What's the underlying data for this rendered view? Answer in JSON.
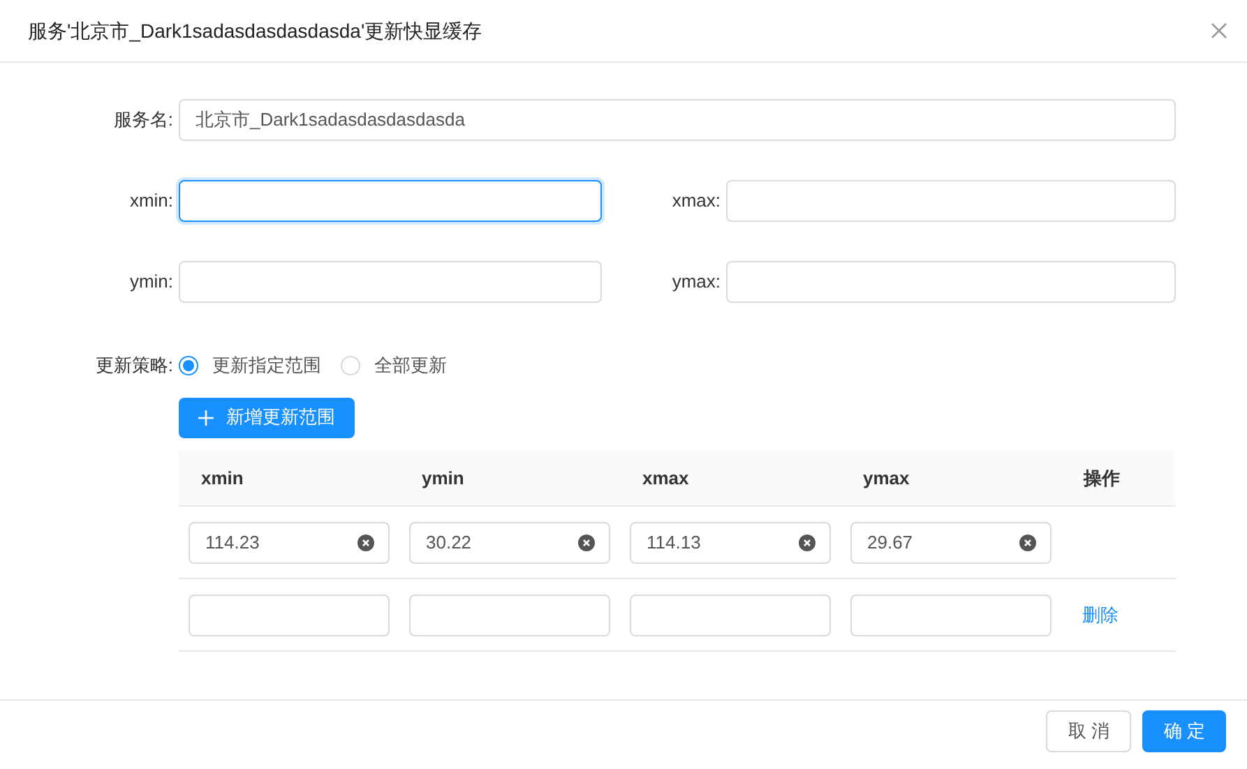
{
  "dialog": {
    "title": "服务'北京市_Dark1sadasdasdasdasda'更新快显缓存"
  },
  "form": {
    "service_name": {
      "label": "服务名:",
      "value": "北京市_Dark1sadasdasdasdasda"
    },
    "bounds": [
      {
        "label": "xmin:",
        "focused": true
      },
      {
        "label": "xmax:",
        "focused": false
      },
      {
        "label": "ymin:",
        "focused": false
      },
      {
        "label": "ymax:",
        "focused": false
      }
    ],
    "strategy": {
      "label": "更新策略:",
      "options": [
        {
          "label": "更新指定范围",
          "selected": true
        },
        {
          "label": "全部更新",
          "selected": false
        }
      ]
    },
    "add_button": "新增更新范围"
  },
  "table": {
    "columns": [
      "xmin",
      "ymin",
      "xmax",
      "ymax",
      "操作"
    ],
    "rows": [
      {
        "cells": [
          "114.23",
          "30.22",
          "114.13",
          "29.67"
        ]
      },
      {
        "action": "删除"
      }
    ]
  },
  "footer": {
    "cancel": "取 消",
    "ok": "确 定"
  }
}
